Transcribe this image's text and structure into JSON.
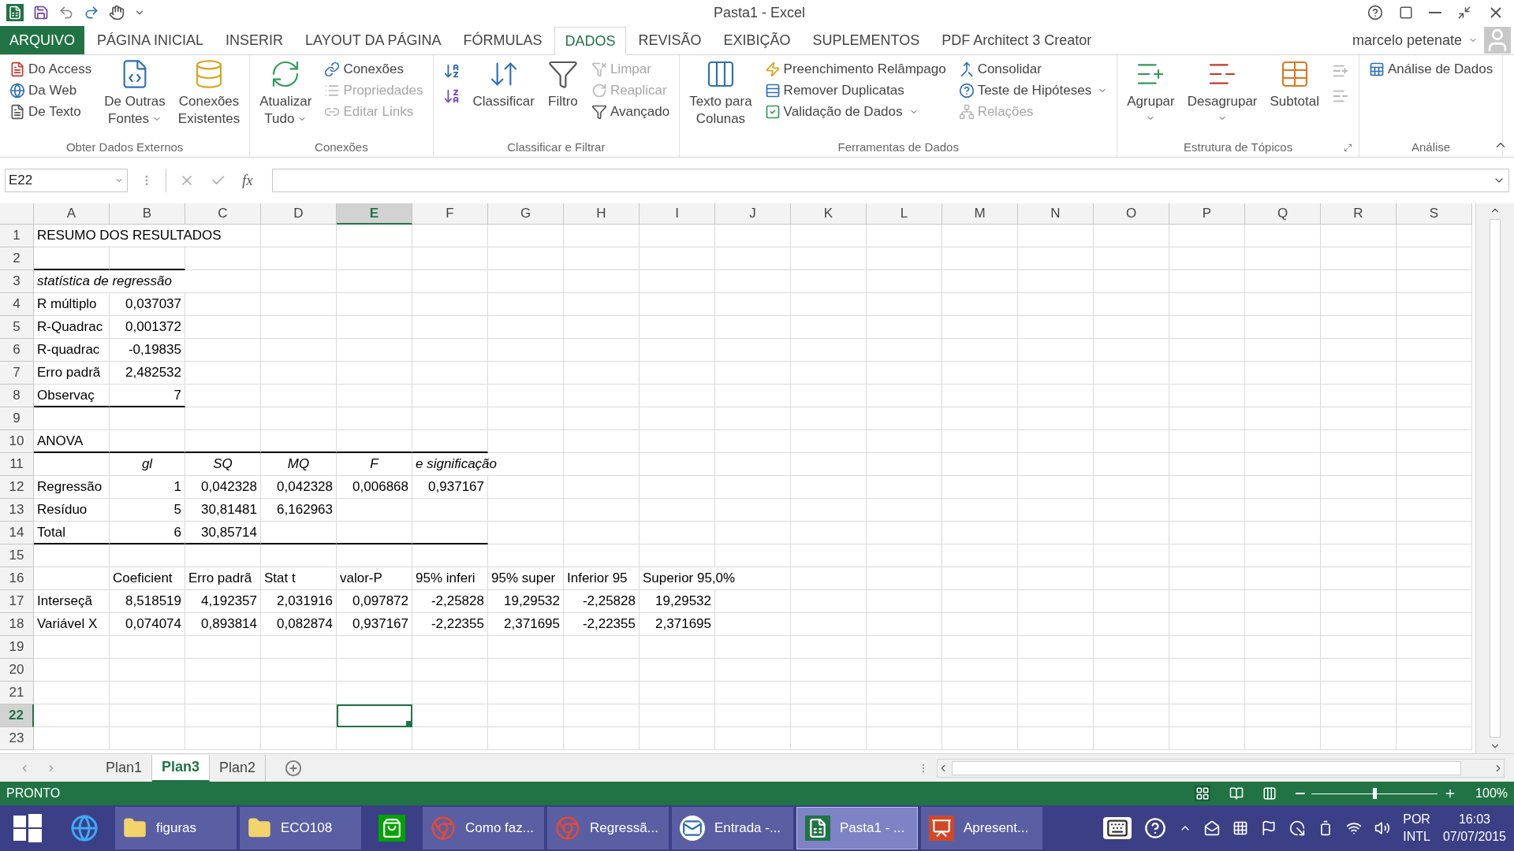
{
  "window": {
    "title": "Pasta1 - Excel",
    "user": "marcelo petenate"
  },
  "tabs": [
    {
      "label": "ARQUIVO",
      "kind": "file",
      "selected": false
    },
    {
      "label": "PÁGINA INICIAL",
      "kind": "tab",
      "selected": false
    },
    {
      "label": "INSERIR",
      "kind": "tab",
      "selected": false
    },
    {
      "label": "LAYOUT DA PÁGINA",
      "kind": "tab",
      "selected": false
    },
    {
      "label": "FÓRMULAS",
      "kind": "tab",
      "selected": false
    },
    {
      "label": "DADOS",
      "kind": "tab",
      "selected": true
    },
    {
      "label": "REVISÃO",
      "kind": "tab",
      "selected": false
    },
    {
      "label": "EXIBIÇÃO",
      "kind": "tab",
      "selected": false
    },
    {
      "label": "SUPLEMENTOS",
      "kind": "tab",
      "selected": false
    },
    {
      "label": "PDF Architect 3 Creator",
      "kind": "tab",
      "selected": false
    }
  ],
  "ribbon": {
    "groups": [
      {
        "label": "Obter Dados Externos",
        "launcher": false,
        "columns": [
          [
            {
              "kind": "small",
              "label": "Do Access",
              "disabled": false,
              "dropdown": false
            },
            {
              "kind": "small",
              "label": "Da Web",
              "disabled": false,
              "dropdown": false
            },
            {
              "kind": "small",
              "label": "De Texto",
              "disabled": false,
              "dropdown": false
            }
          ],
          [
            {
              "kind": "large",
              "lines": [
                "De Outras",
                "Fontes"
              ],
              "disabled": false,
              "dropdown": true
            }
          ],
          [
            {
              "kind": "large",
              "lines": [
                "Conexões",
                "Existentes"
              ],
              "disabled": false,
              "dropdown": false
            }
          ]
        ]
      },
      {
        "label": "Conexões",
        "launcher": false,
        "columns": [
          [
            {
              "kind": "large",
              "lines": [
                "Atualizar",
                "Tudo"
              ],
              "disabled": false,
              "dropdown": true
            }
          ],
          [
            {
              "kind": "small",
              "label": "Conexões",
              "disabled": false,
              "dropdown": false
            },
            {
              "kind": "small",
              "label": "Propriedades",
              "disabled": true,
              "dropdown": false
            },
            {
              "kind": "small",
              "label": "Editar Links",
              "disabled": true,
              "dropdown": false
            }
          ]
        ]
      },
      {
        "label": "Classificar e Filtrar",
        "launcher": false,
        "columns": [
          [
            {
              "kind": "icon",
              "disabled": false,
              "dropdown": false
            },
            {
              "kind": "icon",
              "disabled": false,
              "dropdown": false
            }
          ],
          [
            {
              "kind": "wide",
              "label": "Classificar",
              "disabled": false,
              "dropdown": false
            }
          ],
          [
            {
              "kind": "large",
              "lines": [
                "Filtro"
              ],
              "disabled": false,
              "dropdown": false
            }
          ],
          [
            {
              "kind": "small",
              "label": "Limpar",
              "disabled": true,
              "dropdown": false
            },
            {
              "kind": "small",
              "label": "Reaplicar",
              "disabled": true,
              "dropdown": false
            },
            {
              "kind": "small",
              "label": "Avançado",
              "disabled": false,
              "dropdown": false
            }
          ]
        ]
      },
      {
        "label": "Ferramentas de Dados",
        "launcher": false,
        "columns": [
          [
            {
              "kind": "large",
              "lines": [
                "Texto para",
                "Colunas"
              ],
              "disabled": false,
              "dropdown": false
            }
          ],
          [
            {
              "kind": "small",
              "label": "Preenchimento Relâmpago",
              "disabled": false,
              "dropdown": false
            },
            {
              "kind": "small",
              "label": "Remover Duplicatas",
              "disabled": false,
              "dropdown": false
            },
            {
              "kind": "small",
              "label": "Validação de Dados",
              "disabled": false,
              "dropdown": true
            }
          ],
          [
            {
              "kind": "small",
              "label": "Consolidar",
              "disabled": false,
              "dropdown": false
            },
            {
              "kind": "small",
              "label": "Teste de Hipóteses",
              "disabled": false,
              "dropdown": true
            },
            {
              "kind": "small",
              "label": "Relações",
              "disabled": true,
              "dropdown": false
            }
          ]
        ]
      },
      {
        "label": "Estrutura de Tópicos",
        "launcher": true,
        "columns": [
          [
            {
              "kind": "large",
              "lines": [
                "Agrupar"
              ],
              "disabled": false,
              "dropdown": true
            }
          ],
          [
            {
              "kind": "large",
              "lines": [
                "Desagrupar"
              ],
              "disabled": false,
              "dropdown": true
            }
          ],
          [
            {
              "kind": "large",
              "lines": [
                "Subtotal"
              ],
              "disabled": false,
              "dropdown": false
            }
          ],
          [
            {
              "kind": "icon",
              "disabled": true,
              "dropdown": false
            },
            {
              "kind": "icon",
              "disabled": true,
              "dropdown": false
            }
          ]
        ]
      },
      {
        "label": "Análise",
        "launcher": false,
        "columns": [
          [
            {
              "kind": "small",
              "label": "Análise de Dados",
              "disabled": false,
              "dropdown": false
            }
          ]
        ]
      }
    ]
  },
  "formula_bar": {
    "name_box": "E22",
    "fx": "fx"
  },
  "sheet": {
    "columns": [
      {
        "label": "A",
        "selected": false
      },
      {
        "label": "B",
        "selected": false
      },
      {
        "label": "C",
        "selected": false
      },
      {
        "label": "D",
        "selected": false
      },
      {
        "label": "E",
        "selected": true
      },
      {
        "label": "F",
        "selected": false
      },
      {
        "label": "G",
        "selected": false
      },
      {
        "label": "H",
        "selected": false
      },
      {
        "label": "I",
        "selected": false
      },
      {
        "label": "J",
        "selected": false
      },
      {
        "label": "K",
        "selected": false
      },
      {
        "label": "L",
        "selected": false
      },
      {
        "label": "M",
        "selected": false
      },
      {
        "label": "N",
        "selected": false
      },
      {
        "label": "O",
        "selected": false
      },
      {
        "label": "P",
        "selected": false
      },
      {
        "label": "Q",
        "selected": false
      },
      {
        "label": "R",
        "selected": false
      },
      {
        "label": "S",
        "selected": false
      }
    ],
    "rows": [
      {
        "number": "1",
        "selected": false,
        "cells": [
          {
            "text": "RESUMO DOS RESULTADOS",
            "kind": "text",
            "border_bottom": false
          }
        ]
      },
      {
        "number": "2",
        "selected": false,
        "cells": [
          {
            "kind": "text",
            "border_bottom": true
          },
          {
            "kind": "text",
            "border_bottom": true
          }
        ]
      },
      {
        "number": "3",
        "selected": false,
        "cells": [
          {
            "text": "statística de regressão",
            "kind": "italic",
            "border_bottom": false
          }
        ]
      },
      {
        "number": "4",
        "selected": false,
        "cells": [
          {
            "text": "R múltiplo",
            "kind": "text",
            "border_bottom": false
          },
          {
            "text": "0,037037",
            "kind": "number",
            "border_bottom": false
          }
        ]
      },
      {
        "number": "5",
        "selected": false,
        "cells": [
          {
            "text": "R-Quadrac",
            "kind": "text",
            "border_bottom": false
          },
          {
            "text": "0,001372",
            "kind": "number",
            "border_bottom": false
          }
        ]
      },
      {
        "number": "6",
        "selected": false,
        "cells": [
          {
            "text": "R-quadrac",
            "kind": "text",
            "border_bottom": false
          },
          {
            "text": "-0,19835",
            "kind": "number",
            "border_bottom": false
          }
        ]
      },
      {
        "number": "7",
        "selected": false,
        "cells": [
          {
            "text": "Erro padrã",
            "kind": "text",
            "border_bottom": false
          },
          {
            "text": "2,482532",
            "kind": "number",
            "border_bottom": false
          }
        ]
      },
      {
        "number": "8",
        "selected": false,
        "cells": [
          {
            "text": "Observaç",
            "kind": "text",
            "border_bottom": true
          },
          {
            "text": "7",
            "kind": "number",
            "border_bottom": true
          }
        ]
      },
      {
        "number": "9",
        "selected": false
      },
      {
        "number": "10",
        "selected": false,
        "cells": [
          {
            "text": "ANOVA",
            "kind": "text",
            "border_bottom": true
          },
          {
            "kind": "text",
            "border_bottom": true
          },
          {
            "kind": "text",
            "border_bottom": true
          },
          {
            "kind": "text",
            "border_bottom": true
          },
          {
            "kind": "text",
            "border_bottom": true
          },
          {
            "kind": "text",
            "border_bottom": true
          }
        ]
      },
      {
        "number": "11",
        "selected": false,
        "cells": [
          null,
          {
            "text": "gl",
            "kind": "header",
            "border_bottom": false
          },
          {
            "text": "SQ",
            "kind": "header",
            "border_bottom": false
          },
          {
            "text": "MQ",
            "kind": "header",
            "border_bottom": false
          },
          {
            "text": "F",
            "kind": "header",
            "border_bottom": false
          },
          {
            "text": "e significação",
            "kind": "italic",
            "border_bottom": false
          }
        ]
      },
      {
        "number": "12",
        "selected": false,
        "cells": [
          {
            "text": "Regressão",
            "kind": "text",
            "border_bottom": false
          },
          {
            "text": "1",
            "kind": "number",
            "border_bottom": false
          },
          {
            "text": "0,042328",
            "kind": "number",
            "border_bottom": false
          },
          {
            "text": "0,042328",
            "kind": "number",
            "border_bottom": false
          },
          {
            "text": "0,006868",
            "kind": "number",
            "border_bottom": false
          },
          {
            "text": "0,937167",
            "kind": "number",
            "border_bottom": false
          }
        ]
      },
      {
        "number": "13",
        "selected": false,
        "cells": [
          {
            "text": "Resíduo",
            "kind": "text",
            "border_bottom": false
          },
          {
            "text": "5",
            "kind": "number",
            "border_bottom": false
          },
          {
            "text": "30,81481",
            "kind": "number",
            "border_bottom": false
          },
          {
            "text": "6,162963",
            "kind": "number",
            "border_bottom": false
          }
        ]
      },
      {
        "number": "14",
        "selected": false,
        "cells": [
          {
            "text": "Total",
            "kind": "text",
            "border_bottom": true
          },
          {
            "text": "6",
            "kind": "number",
            "border_bottom": true
          },
          {
            "text": "30,85714",
            "kind": "number",
            "border_bottom": true
          },
          {
            "kind": "text",
            "border_bottom": true
          },
          {
            "kind": "text",
            "border_bottom": true
          },
          {
            "kind": "text",
            "border_bottom": true
          }
        ]
      },
      {
        "number": "15",
        "selected": false
      },
      {
        "number": "16",
        "selected": false,
        "cells": [
          null,
          {
            "text": "Coeficient",
            "kind": "text",
            "border_bottom": false
          },
          {
            "text": "Erro padrã",
            "kind": "text",
            "border_bottom": false
          },
          {
            "text": "Stat t",
            "kind": "text",
            "border_bottom": false
          },
          {
            "text": "valor-P",
            "kind": "text",
            "border_bottom": false
          },
          {
            "text": "95% inferi",
            "kind": "text",
            "border_bottom": false
          },
          {
            "text": "95% super",
            "kind": "text",
            "border_bottom": false
          },
          {
            "text": "Inferior 95",
            "kind": "text",
            "border_bottom": false
          },
          {
            "text": "Superior 95,0%",
            "kind": "text",
            "border_bottom": false
          }
        ]
      },
      {
        "number": "17",
        "selected": false,
        "cells": [
          {
            "text": "Interseçã",
            "kind": "text",
            "border_bottom": false
          },
          {
            "text": "8,518519",
            "kind": "number",
            "border_bottom": false
          },
          {
            "text": "4,192357",
            "kind": "number",
            "border_bottom": false
          },
          {
            "text": "2,031916",
            "kind": "number",
            "border_bottom": false
          },
          {
            "text": "0,097872",
            "kind": "number",
            "border_bottom": false
          },
          {
            "text": "-2,25828",
            "kind": "number",
            "border_bottom": false
          },
          {
            "text": "19,29532",
            "kind": "number",
            "border_bottom": false
          },
          {
            "text": "-2,25828",
            "kind": "number",
            "border_bottom": false
          },
          {
            "text": "19,29532",
            "kind": "number",
            "border_bottom": false
          }
        ]
      },
      {
        "number": "18",
        "selected": false,
        "cells": [
          {
            "text": "Variável X",
            "kind": "text",
            "border_bottom": false
          },
          {
            "text": "0,074074",
            "kind": "number",
            "border_bottom": false
          },
          {
            "text": "0,893814",
            "kind": "number",
            "border_bottom": false
          },
          {
            "text": "0,082874",
            "kind": "number",
            "border_bottom": false
          },
          {
            "text": "0,937167",
            "kind": "number",
            "border_bottom": false
          },
          {
            "text": "-2,22355",
            "kind": "number",
            "border_bottom": false
          },
          {
            "text": "2,371695",
            "kind": "number",
            "border_bottom": false
          },
          {
            "text": "-2,22355",
            "kind": "number",
            "border_bottom": false
          },
          {
            "text": "2,371695",
            "kind": "number",
            "border_bottom": false
          }
        ]
      },
      {
        "number": "19",
        "selected": false
      },
      {
        "number": "20",
        "selected": false
      },
      {
        "number": "21",
        "selected": false
      },
      {
        "number": "22",
        "selected": true
      },
      {
        "number": "23",
        "selected": false
      }
    ]
  },
  "sheet_tabs": [
    {
      "label": "Plan1",
      "selected": false
    },
    {
      "label": "Plan3",
      "selected": true
    },
    {
      "label": "Plan2",
      "selected": false
    }
  ],
  "status_bar": {
    "status": "PRONTO",
    "zoom": {
      "level": 0.5,
      "reading": "100%"
    }
  },
  "taskbar": {
    "items": [
      {
        "kind": "ie",
        "selected": false
      },
      {
        "kind": "folder",
        "label": "figuras",
        "selected": false
      },
      {
        "kind": "folder",
        "label": "ECO108",
        "selected": false
      },
      {
        "kind": "store",
        "selected": false
      },
      {
        "kind": "browser",
        "label": "Como faz...",
        "selected": false
      },
      {
        "kind": "browser",
        "label": "Regressã...",
        "selected": false
      },
      {
        "kind": "mail",
        "label": "Entrada -...",
        "selected": false
      },
      {
        "kind": "sheet",
        "label": "Pasta1 - ...",
        "selected": true
      },
      {
        "kind": "slides",
        "label": "Apresent...",
        "selected": false
      }
    ],
    "language": [
      "POR",
      "INTL"
    ],
    "time": "16:03",
    "date": "07/07/2015"
  }
}
